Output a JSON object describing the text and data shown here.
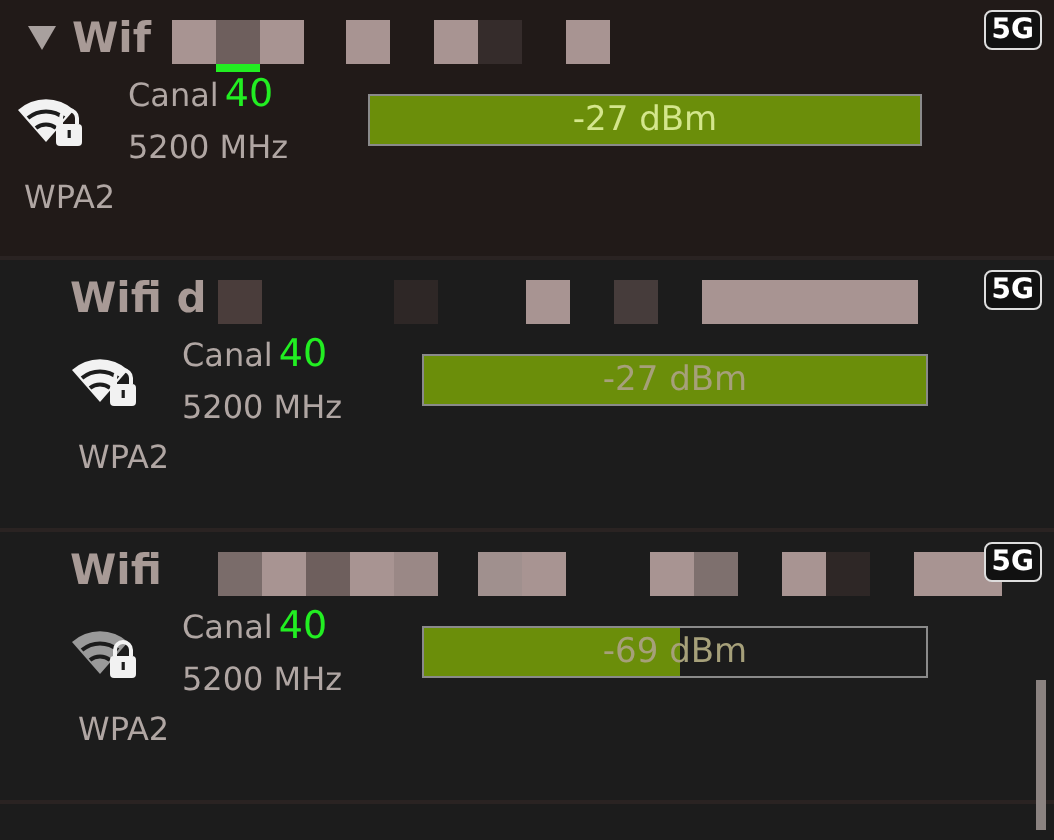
{
  "networks": [
    {
      "title": "Wif",
      "expanded": true,
      "badge": "5G",
      "channel_label": "Canal",
      "channel": "40",
      "frequency": "5200 MHz",
      "security": "WPA2",
      "level": 1.0,
      "reading": "-27 dBm",
      "children": [
        {
          "title": "Wifi d",
          "badge": "5G",
          "channel_label": "Canal",
          "channel": "40",
          "frequency": "5200 MHz",
          "security": "WPA2",
          "level": 1.0,
          "reading": "-27 dBm"
        },
        {
          "title": "Wifi",
          "badge": "5G",
          "channel_label": "Canal",
          "channel": "40",
          "frequency": "5200 MHz",
          "security": "WPA2",
          "level": 0.51,
          "reading": "-69 dBm"
        }
      ]
    }
  ]
}
